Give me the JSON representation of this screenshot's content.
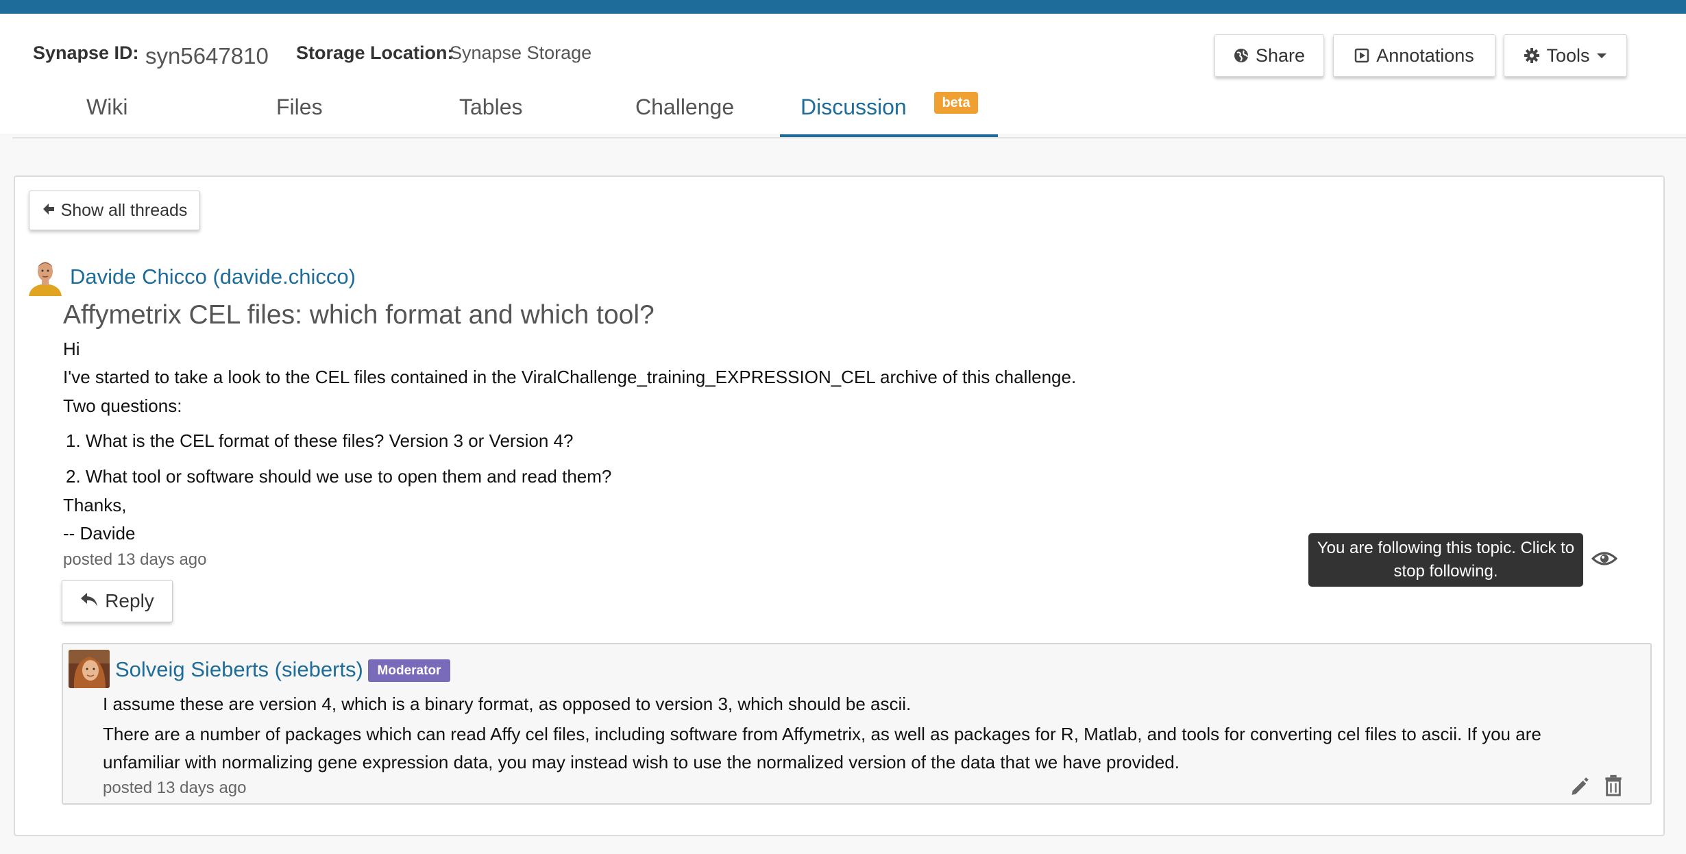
{
  "header": {
    "synapse_id_label": "Synapse ID:",
    "synapse_id": "syn5647810",
    "storage_label": "Storage Location:",
    "storage_value": "Synapse Storage",
    "buttons": {
      "share": "Share",
      "annotations": "Annotations",
      "tools": "Tools"
    }
  },
  "tabs": [
    {
      "label": "Wiki"
    },
    {
      "label": "Files"
    },
    {
      "label": "Tables"
    },
    {
      "label": "Challenge"
    },
    {
      "label": "Discussion",
      "badge": "beta",
      "active": true
    }
  ],
  "thread": {
    "back_button": "Show all threads",
    "author": "Davide Chicco (davide.chicco)",
    "title": "Affymetrix CEL files: which format and which tool?",
    "body": {
      "greeting": "Hi",
      "line1": "I've started to take a look to the CEL files contained in the ViralChallenge_training_EXPRESSION_CEL archive of this challenge.",
      "line2": "Two questions:",
      "list": [
        "1. What is the CEL format of these files? Version 3 or Version 4?",
        "2. What tool or software should we use to open them and read them?"
      ],
      "thanks": "Thanks,",
      "signature": "-- Davide"
    },
    "posted": "posted 13 days ago",
    "reply_button": "Reply",
    "follow_tooltip": "You are following this topic. Click to stop following."
  },
  "reply": {
    "author": "Solveig Sieberts (sieberts)",
    "badge": "Moderator",
    "line1": "I assume these are version 4, which is a binary format, as opposed to version 3, which should be ascii.",
    "para2": "There are a number of packages which can read Affy cel files, including software from Affymetrix, as well as packages for R, Matlab, and tools for converting cel files to ascii. If you are unfamiliar with normalizing gene expression data, you may instead wish to use the normalized version of the data that we have provided.",
    "posted": "posted 13 days ago"
  },
  "colors": {
    "brand": "#1e6c99",
    "beta_badge": "#f0a030",
    "moderator_badge": "#7a6aba",
    "tooltip_bg": "#333333"
  },
  "icons": [
    "globe-icon",
    "annotations-icon",
    "gear-icon",
    "caret-down-icon",
    "arrow-left-icon",
    "reply-icon",
    "eye-icon",
    "pencil-icon",
    "trash-icon"
  ]
}
